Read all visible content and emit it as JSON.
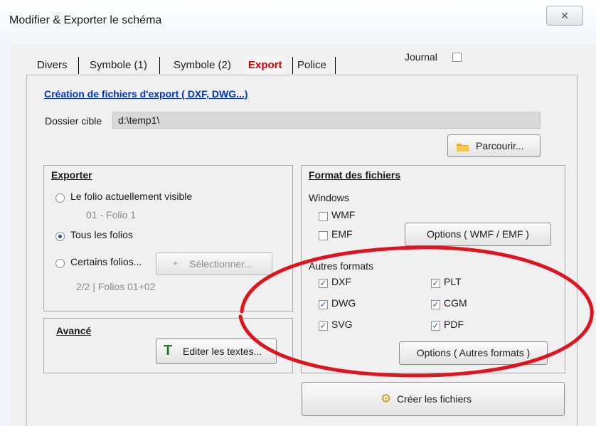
{
  "window": {
    "title": "Modifier & Exporter le schéma",
    "close_glyph": "✕"
  },
  "tabs": [
    {
      "label": "Divers",
      "active": false
    },
    {
      "label": "Symbole (1)",
      "active": false
    },
    {
      "label": "Symbole (2)",
      "active": false
    },
    {
      "label": "Export",
      "active": true
    },
    {
      "label": "Police",
      "active": false
    }
  ],
  "journal": {
    "label": "Journal",
    "checked": false
  },
  "export": {
    "section_link": "Création de fichiers d'export ( DXF, DWG...)",
    "dossier_label": "Dossier cible",
    "dossier_value": "d:\\temp1\\",
    "browse_label": "Parcourir...",
    "browse_icon": "folder-icon"
  },
  "exporter": {
    "title": "Exporter",
    "option_visible": "Le folio actuellement visible",
    "visible_sub": "01 - Folio 1",
    "option_all": "Tous les folios",
    "option_some": "Certains folios...",
    "select_label": "Sélectionner...",
    "some_sub": "2/2  |  Folios 01+02",
    "selected_option": "all"
  },
  "avance": {
    "title": "Avancé",
    "edit_label": "Editer les textes...",
    "edit_icon": "text-icon"
  },
  "format": {
    "title": "Format des fichiers",
    "windows_label": "Windows",
    "windows_formats": [
      {
        "label": "WMF",
        "checked": false
      },
      {
        "label": "EMF",
        "checked": false
      }
    ],
    "options_wmf_label": "Options ( WMF / EMF )",
    "autres_label": "Autres formats",
    "autres_formats": [
      {
        "label": "DXF",
        "checked": true
      },
      {
        "label": "PLT",
        "checked": true
      },
      {
        "label": "DWG",
        "checked": true
      },
      {
        "label": "CGM",
        "checked": true
      },
      {
        "label": "SVG",
        "checked": true
      },
      {
        "label": "PDF",
        "checked": true
      }
    ],
    "options_autres_label": "Options ( Autres formats )"
  },
  "create": {
    "label": "Créer les fichiers",
    "icon": "gears-icon"
  },
  "colors": {
    "active_tab": "#d00000",
    "link": "#0033cc",
    "annotation": "#e0141e",
    "checkmark": "#2b5fb4"
  }
}
